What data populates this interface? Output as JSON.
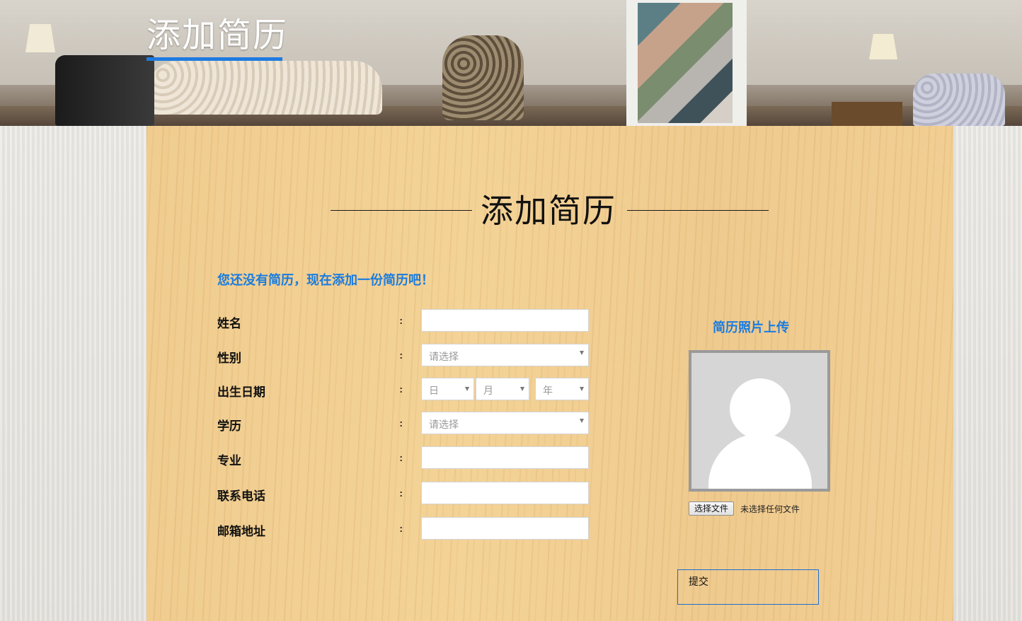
{
  "banner": {
    "title": "添加简历"
  },
  "main": {
    "heading": "添加简历",
    "notice": "您还没有简历，现在添加一份简历吧！",
    "colon": ":",
    "fields": {
      "name": {
        "label": "姓名",
        "value": ""
      },
      "gender": {
        "label": "性别",
        "placeholder": "请选择"
      },
      "birth": {
        "label": "出生日期",
        "day_placeholder": "日",
        "month_placeholder": "月",
        "year_placeholder": "年"
      },
      "education": {
        "label": "学历",
        "placeholder": "请选择"
      },
      "major": {
        "label": "专业",
        "value": ""
      },
      "phone": {
        "label": "联系电话",
        "value": ""
      },
      "email": {
        "label": "邮箱地址",
        "value": ""
      }
    },
    "photo": {
      "title": "简历照片上传",
      "file_button": "选择文件",
      "file_status": "未选择任何文件"
    },
    "submit_label": "提交"
  },
  "colors": {
    "accent": "#1a7ce0",
    "wood": "#f0cd92"
  }
}
